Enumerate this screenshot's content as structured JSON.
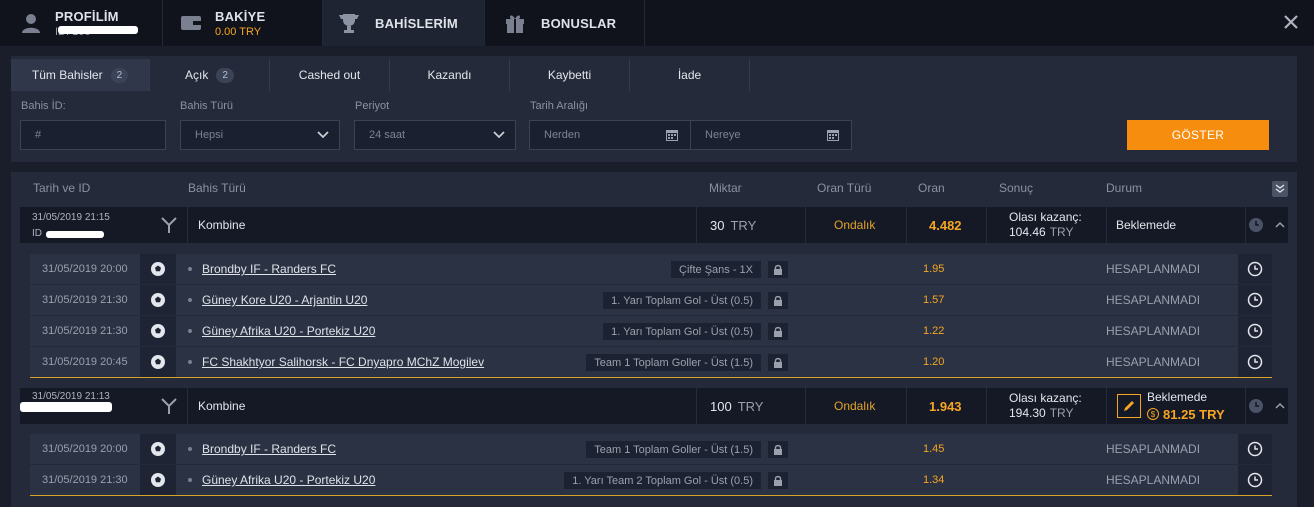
{
  "tabs": {
    "profile": {
      "title": "PROFİLİM",
      "sub": "ID: 106"
    },
    "bakiye": {
      "title": "BAKİYE",
      "sub": "0.00 TRY"
    },
    "bahislerim": {
      "title": "BAHİSLERİM"
    },
    "bonuslar": {
      "title": "BONUSLAR"
    }
  },
  "filter_tabs": [
    {
      "label": "Tüm Bahisler",
      "count": "2"
    },
    {
      "label": "Açık",
      "count": "2"
    },
    {
      "label": "Cashed out"
    },
    {
      "label": "Kazandı"
    },
    {
      "label": "Kaybetti"
    },
    {
      "label": "İade"
    }
  ],
  "filters": {
    "bahis_id_label": "Bahis İD:",
    "bahis_id_placeholder": "#",
    "bahis_turu_label": "Bahis Türü",
    "bahis_turu_value": "Hepsi",
    "periyot_label": "Periyot",
    "periyot_value": "24 saat",
    "tarih_label": "Tarih Aralığı",
    "from_placeholder": "Nerden",
    "to_placeholder": "Nereye",
    "show_button": "GÖSTER"
  },
  "table_headers": {
    "date": "Tarih ve ID",
    "type": "Bahis Türü",
    "amount": "Miktar",
    "odds_type": "Oran Türü",
    "odds": "Oran",
    "result": "Sonuç",
    "status": "Durum"
  },
  "bets": [
    {
      "date": "31/05/2019 21:15",
      "id_prefix": "ID",
      "type": "Kombine",
      "amount": "30",
      "currency": "TRY",
      "odds_type": "Ondalık",
      "odds": "4.482",
      "result_label": "Olası kazanç:",
      "result_value": "104.46",
      "result_currency": "TRY",
      "status": "Beklemede",
      "selections": [
        {
          "date": "31/05/2019 20:00",
          "event": "Brondby IF - Randers FC",
          "market": "Çifte Şans - 1X",
          "odds": "1.95",
          "status": "HESAPLANMADI"
        },
        {
          "date": "31/05/2019 21:30",
          "event": "Güney Kore U20 - Arjantin U20",
          "market": "1. Yarı Toplam Gol - Üst (0.5)",
          "odds": "1.57",
          "status": "HESAPLANMADI"
        },
        {
          "date": "31/05/2019 21:30",
          "event": "Güney Afrika U20 - Portekiz U20",
          "market": "1. Yarı Toplam Gol - Üst (0.5)",
          "odds": "1.22",
          "status": "HESAPLANMADI"
        },
        {
          "date": "31/05/2019 20:45",
          "event": "FC Shakhtyor Salihorsk - FC Dnyapro MChZ Mogilev",
          "market": "Team 1 Toplam Goller - Üst (1.5)",
          "odds": "1.20",
          "status": "HESAPLANMADI"
        }
      ]
    },
    {
      "date": "31/05/2019 21:13",
      "type": "Kombine",
      "amount": "100",
      "currency": "TRY",
      "odds_type": "Ondalık",
      "odds": "1.943",
      "result_label": "Olası kazanç:",
      "result_value": "194.30",
      "result_currency": "TRY",
      "status": "Beklemede",
      "cashout": "81.25 TRY",
      "selections": [
        {
          "date": "31/05/2019 20:00",
          "event": "Brondby IF - Randers FC",
          "market": "Team 1 Toplam Goller - Üst (1.5)",
          "odds": "1.45",
          "status": "HESAPLANMADI"
        },
        {
          "date": "31/05/2019 21:30",
          "event": "Güney Afrika U20 - Portekiz U20",
          "market": "1. Yarı Team 2 Toplam Gol - Üst (0.5)",
          "odds": "1.34",
          "status": "HESAPLANMADI"
        }
      ]
    }
  ],
  "colors": {
    "accent": "#f68d0f",
    "odds": "#f6a623",
    "bg": "#1a1e2b"
  }
}
